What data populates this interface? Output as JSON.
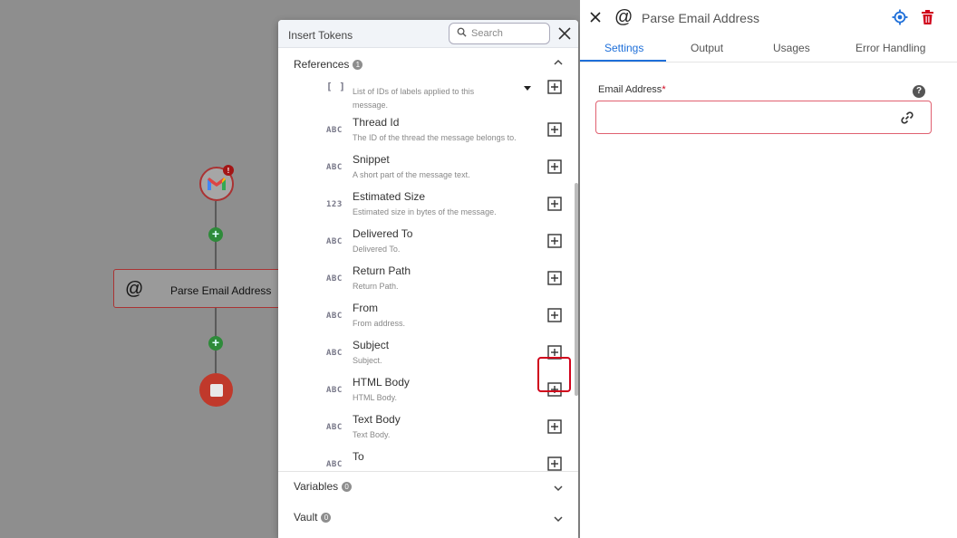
{
  "canvas": {
    "parse_node_label": "Parse Email Address",
    "parse_node_icon": "@",
    "gmail_badge": "!"
  },
  "tokens_popup": {
    "title": "Insert Tokens",
    "search_placeholder": "Search",
    "sections": {
      "references": {
        "label": "References",
        "count": "1"
      },
      "variables": {
        "label": "Variables",
        "count": "0"
      },
      "vault": {
        "label": "Vault",
        "count": "0"
      }
    },
    "items": [
      {
        "type": "[ ]",
        "name": "",
        "desc": "List of IDs of labels applied to this",
        "desc2": "message."
      },
      {
        "type": "ABC",
        "name": "Thread Id",
        "desc": "The ID of the thread the message belongs to."
      },
      {
        "type": "ABC",
        "name": "Snippet",
        "desc": "A short part of the message text."
      },
      {
        "type": "123",
        "name": "Estimated Size",
        "desc": "Estimated size in bytes of the message."
      },
      {
        "type": "ABC",
        "name": "Delivered To",
        "desc": "Delivered To."
      },
      {
        "type": "ABC",
        "name": "Return Path",
        "desc": "Return Path."
      },
      {
        "type": "ABC",
        "name": "From",
        "desc": "From address."
      },
      {
        "type": "ABC",
        "name": "Subject",
        "desc": "Subject."
      },
      {
        "type": "ABC",
        "name": "HTML Body",
        "desc": "HTML Body."
      },
      {
        "type": "ABC",
        "name": "Text Body",
        "desc": "Text Body."
      },
      {
        "type": "ABC",
        "name": "To",
        "desc": ""
      }
    ]
  },
  "panel": {
    "icon": "@",
    "title": "Parse Email Address",
    "tabs": [
      "Settings",
      "Output",
      "Usages",
      "Error Handling"
    ],
    "active_tab": "Settings",
    "field_label": "Email Address",
    "field_required": "*",
    "field_value": "",
    "help": "?"
  },
  "colors": {
    "accent": "#1e6fd9",
    "danger": "#d0021b",
    "add_green": "#2e8b3a"
  }
}
